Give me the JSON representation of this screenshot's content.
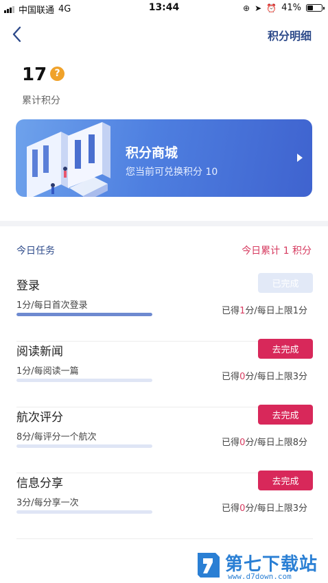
{
  "status_bar": {
    "carrier": "中国联通",
    "network": "4G",
    "time": "13:44",
    "battery": "41%"
  },
  "header": {
    "detail_link": "积分明细"
  },
  "points": {
    "value": "17",
    "help": "?",
    "label": "累计积分"
  },
  "banner": {
    "title": "积分商城",
    "subtitle": "您当前可兑换积分 10"
  },
  "tasks": {
    "title": "今日任务",
    "total": "今日累计 1 积分",
    "items": [
      {
        "name": "登录",
        "desc": "1分/每日首次登录",
        "button": "已完成",
        "status": "done",
        "earned_prefix": "已得",
        "earned_value": "1",
        "earned_suffix": "分/每日上限1分",
        "progress": 1.0
      },
      {
        "name": "阅读新闻",
        "desc": "1分/每阅读一篇",
        "button": "去完成",
        "status": "todo",
        "earned_prefix": "已得",
        "earned_value": "0",
        "earned_suffix": "分/每日上限3分",
        "progress": 0.0
      },
      {
        "name": "航次评分",
        "desc": "8分/每评分一个航次",
        "button": "去完成",
        "status": "todo",
        "earned_prefix": "已得",
        "earned_value": "0",
        "earned_suffix": "分/每日上限8分",
        "progress": 0.0
      },
      {
        "name": "信息分享",
        "desc": "3分/每分享一次",
        "button": "去完成",
        "status": "todo",
        "earned_prefix": "已得",
        "earned_value": "0",
        "earned_suffix": "分/每日上限3分",
        "progress": 0.0
      }
    ]
  },
  "watermark": {
    "text": "第七下载站",
    "url": "www.d7down.com"
  },
  "colors": {
    "accent_blue": "#2d4a8a",
    "accent_red": "#d8285a",
    "help_orange": "#f0a22a"
  }
}
